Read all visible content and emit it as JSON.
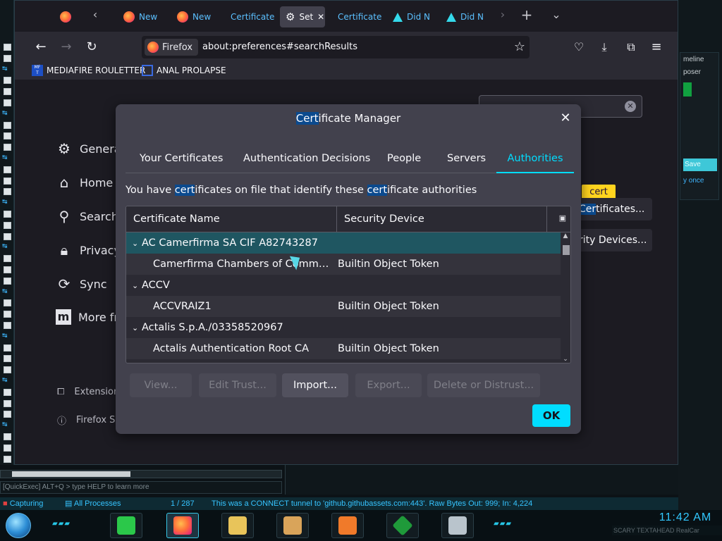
{
  "tabs": [
    {
      "label": "",
      "icon": "firefox-icon"
    },
    {
      "label": "New",
      "icon": "firefox-icon"
    },
    {
      "label": "New",
      "icon": "firefox-icon"
    },
    {
      "label": "Certificate",
      "icon": ""
    },
    {
      "label": "Set",
      "icon": "gear-icon"
    },
    {
      "label": "Certificate",
      "icon": ""
    },
    {
      "label": "Did N",
      "icon": "warning-icon"
    },
    {
      "label": "Did N",
      "icon": "warning-icon"
    }
  ],
  "identity_label": "Firefox",
  "url": "about:preferences#searchResults",
  "bookmarks": [
    {
      "label": "MEDIAFIRE ROULETTER",
      "icon_text": "MF\nT"
    },
    {
      "label": "ANAL PROLAPSE",
      "icon_text": ""
    }
  ],
  "prefs": {
    "categories": [
      {
        "label": "Genera",
        "icon": "gear-icon"
      },
      {
        "label": "Home",
        "icon": "home-icon"
      },
      {
        "label": "Search",
        "icon": "search-icon"
      },
      {
        "label": "Privacy",
        "icon": "lock-icon"
      },
      {
        "label": "Sync",
        "icon": "sync-icon"
      },
      {
        "label": "More fr",
        "icon": "mozilla-icon"
      }
    ],
    "footer": [
      {
        "label": "Extension",
        "icon": "puzzle-icon"
      },
      {
        "label": "Firefox Su",
        "icon": "help-icon"
      }
    ],
    "view_certs_prefix": "",
    "view_certs_highlight": "Cer",
    "view_certs_suffix": "tificates...",
    "security_devices": "rity Devices...",
    "cert_badge": "cert"
  },
  "dialog": {
    "title_highlight": "Cert",
    "title_rest": "ificate Manager",
    "tabs": [
      "Your Certificates",
      "Authentication Decisions",
      "People",
      "Servers",
      "Authorities"
    ],
    "selected_tab": "Authorities",
    "desc_parts": [
      "You have ",
      "cert",
      "ificates on file that identify these ",
      "cert",
      "ificate authorities"
    ],
    "columns": [
      "Certificate Name",
      "Security Device"
    ],
    "rows": [
      {
        "name": "AC Camerfirma SA CIF A82743287",
        "device": "",
        "group": true,
        "selected": true
      },
      {
        "name": "Camerfirma Chambers of Commerce ...",
        "device": "Builtin Object Token",
        "group": false
      },
      {
        "name": "ACCV",
        "device": "",
        "group": true
      },
      {
        "name": "ACCVRAIZ1",
        "device": "Builtin Object Token",
        "group": false
      },
      {
        "name": "Actalis S.p.A./03358520967",
        "device": "",
        "group": true
      },
      {
        "name": "Actalis Authentication Root CA",
        "device": "Builtin Object Token",
        "group": false
      }
    ],
    "buttons": [
      {
        "label": "View...",
        "enabled": false
      },
      {
        "label": "Edit Trust...",
        "enabled": false
      },
      {
        "label": "Import...",
        "enabled": true
      },
      {
        "label": "Export...",
        "enabled": false
      },
      {
        "label": "Delete or Distrust...",
        "enabled": false
      }
    ],
    "ok_label": "OK"
  },
  "right_pane": {
    "line1": "meline",
    "line2": "poser",
    "line3": "",
    "save": "Save",
    "once": "y once"
  },
  "console": {
    "quickexec": "[QuickExec] ALT+Q > type HELP to learn more"
  },
  "status": {
    "capturing": "Capturing",
    "processes": "All Processes",
    "count": "1 / 287",
    "message": "This was a CONNECT tunnel to 'github.githubassets.com:443'. Raw Bytes Out: 999; In: 4,224"
  },
  "clock": {
    "time": "11:42 AM",
    "sub": "SCARY TEXTAHEAD  RealCar"
  },
  "colors": {
    "accent": "#00ddff",
    "dialog_bg": "#42414d",
    "selected_row": "#1f5661",
    "status_text": "#36c4ff"
  }
}
